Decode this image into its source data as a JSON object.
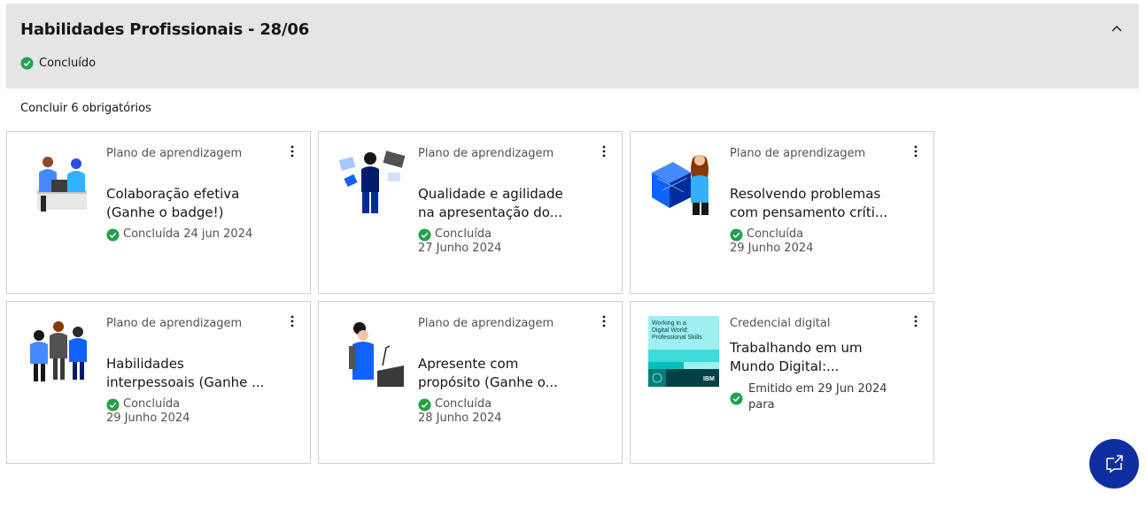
{
  "section": {
    "title": "Habilidades Profissionais - 28/06",
    "status": "Concluído",
    "required": "Concluir 6 obrigatórios"
  },
  "cards": [
    {
      "type": "Plano de aprendizagem",
      "title_line1": "Colaboração efetiva",
      "title_line2": "(Ganhe o badge!)",
      "status_line1": "Concluída 24 jun 2024",
      "status_line2": ""
    },
    {
      "type": "Plano de aprendizagem",
      "title_line1": "Qualidade e agilidade",
      "title_line2": "na apresentação do...",
      "status_line1": "Concluída",
      "status_line2": "27 Junho 2024"
    },
    {
      "type": "Plano de aprendizagem",
      "title_line1": "Resolvendo problemas",
      "title_line2": "com pensamento críti...",
      "status_line1": "Concluída",
      "status_line2": "29 Junho 2024"
    },
    {
      "type": "Plano de aprendizagem",
      "title_line1": "Habilidades",
      "title_line2": "interpessoais (Ganhe ...",
      "status_line1": "Concluída",
      "status_line2": "29 Junho 2024"
    },
    {
      "type": "Plano de aprendizagem",
      "title_line1": "Apresente com",
      "title_line2": "propósito (Ganhe o...",
      "status_line1": "Concluída",
      "status_line2": "28 Junho 2024"
    },
    {
      "type": "Credencial digital",
      "title_line1": "Trabalhando em um",
      "title_line2": "Mundo Digital:...",
      "status_line1": "Emitido em 29 Jun 2024",
      "status_line2": "para",
      "cover": {
        "line1": "Working in a",
        "line2": "Digital World:",
        "line3": "Professional Skills",
        "brand": "IBM"
      }
    }
  ],
  "icons": {
    "collapse": "chevron-up-icon",
    "status": "checkmark-filled-icon",
    "overflow": "overflow-menu-vertical-icon",
    "fab": "launch-chat-icon"
  },
  "colors": {
    "success": "#24a148",
    "fab": "#0f2fa0",
    "header_bg": "#e5e5e5",
    "accent_blue": "#0f62fe"
  }
}
